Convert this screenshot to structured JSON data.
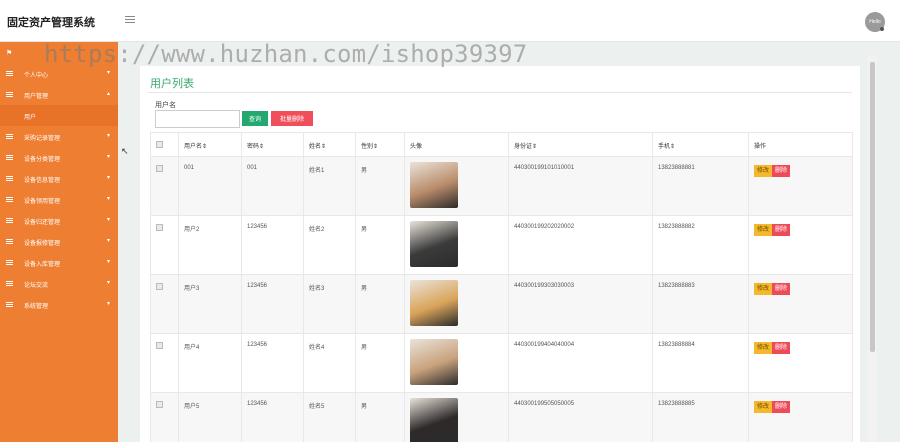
{
  "header": {
    "app_title": "固定资产管理系统",
    "avatar_text": "Hello"
  },
  "watermark": "https://www.huzhan.com/ishop39397",
  "sidebar": {
    "items": [
      {
        "label": ""
      },
      {
        "label": "个人中心"
      },
      {
        "label": "用户管理"
      },
      {
        "label": "用户"
      },
      {
        "label": "采购记录管理"
      },
      {
        "label": "设备分类管理"
      },
      {
        "label": "设备信息管理"
      },
      {
        "label": "设备领用管理"
      },
      {
        "label": "设备归还管理"
      },
      {
        "label": "设备报修管理"
      },
      {
        "label": "设备入库管理"
      },
      {
        "label": "论坛交流"
      },
      {
        "label": "系统管理"
      }
    ]
  },
  "main": {
    "title": "用户列表",
    "search": {
      "label": "用户名",
      "value": "",
      "placeholder": ""
    },
    "query_button": "查询",
    "batch_delete_button": "批量删除",
    "columns": [
      "",
      "用户名⇕",
      "密码⇕",
      "姓名⇕",
      "性别⇕",
      "头像",
      "身份证⇕",
      "手机⇕",
      "操作"
    ],
    "rows": [
      {
        "username": "001",
        "password": "001",
        "name": "姓名1",
        "gender": "男",
        "id_card": "440300199101010001",
        "phone": "13823888881",
        "avatar_color": "#b98c6a"
      },
      {
        "username": "用户2",
        "password": "123456",
        "name": "姓名2",
        "gender": "男",
        "id_card": "440300199202020002",
        "phone": "13823888882",
        "avatar_color": "#3b3b3b"
      },
      {
        "username": "用户3",
        "password": "123456",
        "name": "姓名3",
        "gender": "男",
        "id_card": "440300199303030003",
        "phone": "13823888883",
        "avatar_color": "#d9a45a"
      },
      {
        "username": "用户4",
        "password": "123456",
        "name": "姓名4",
        "gender": "男",
        "id_card": "440300199404040004",
        "phone": "13823888884",
        "avatar_color": "#c8a27c"
      },
      {
        "username": "用户5",
        "password": "123456",
        "name": "姓名5",
        "gender": "男",
        "id_card": "440300199505050005",
        "phone": "13823888885",
        "avatar_color": "#2e2a2a"
      }
    ],
    "edit_label": "修改",
    "delete_label": "删除"
  },
  "colors": {
    "sidebar": "#ee7e31",
    "accent_green": "#23a86f",
    "danger": "#ef4f5a",
    "warning": "#f3b82b"
  }
}
